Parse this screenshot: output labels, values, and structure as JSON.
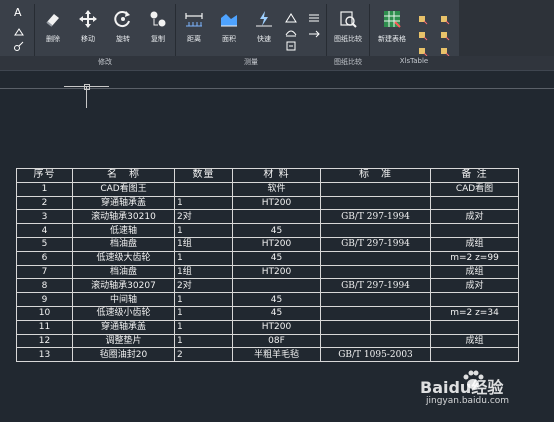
{
  "ribbon": {
    "tools": [
      {
        "label": "删除",
        "icon": "eraser-icon"
      },
      {
        "label": "移动",
        "icon": "move-icon"
      },
      {
        "label": "旋转",
        "icon": "rotate-icon"
      },
      {
        "label": "复制",
        "icon": "copy-icon"
      },
      {
        "label": "距离",
        "icon": "distance-icon"
      },
      {
        "label": "面积",
        "icon": "area-icon"
      },
      {
        "label": "快速",
        "icon": "quick-measure-icon"
      },
      {
        "label": "图纸比较",
        "icon": "compare-drawing-icon"
      },
      {
        "label": "新建表格",
        "icon": "new-table-icon"
      }
    ],
    "panels": [
      "修改",
      "测量",
      "图纸比较",
      "XlsTable"
    ]
  },
  "bom_table": {
    "headers": [
      "序号",
      "名　称",
      "数量",
      "材 料",
      "标　准",
      "备 注"
    ],
    "rows": [
      [
        "1",
        "CAD看图王",
        "",
        "软件",
        "",
        "CAD看图"
      ],
      [
        "2",
        "穿通轴承盖",
        "1",
        "HT200",
        "",
        ""
      ],
      [
        "3",
        "滚动轴承30210",
        "2对",
        "",
        "GB/T 297-1994",
        "成对"
      ],
      [
        "4",
        "低速轴",
        "1",
        "45",
        "",
        ""
      ],
      [
        "5",
        "档油盘",
        "1组",
        "HT200",
        "GB/T 297-1994",
        "成组"
      ],
      [
        "6",
        "低速级大齿轮",
        "1",
        "45",
        "",
        "m=2 z=99"
      ],
      [
        "7",
        "档油盘",
        "1组",
        "HT200",
        "",
        "成组"
      ],
      [
        "8",
        "滚动轴承30207",
        "2对",
        "",
        "GB/T 297-1994",
        "成对"
      ],
      [
        "9",
        "中间轴",
        "1",
        "45",
        "",
        ""
      ],
      [
        "10",
        "低速级小齿轮",
        "1",
        "45",
        "",
        "m=2 z=34"
      ],
      [
        "11",
        "穿通轴承盖",
        "1",
        "HT200",
        "",
        ""
      ],
      [
        "12",
        "调整垫片",
        "1",
        "08F",
        "",
        "成组"
      ],
      [
        "13",
        "毡圈油封20",
        "2",
        "半粗羊毛毡",
        "GB/T 1095-2003",
        ""
      ]
    ]
  },
  "watermark": {
    "brand": "Baidu经验",
    "url": "jingyan.baidu.com"
  }
}
